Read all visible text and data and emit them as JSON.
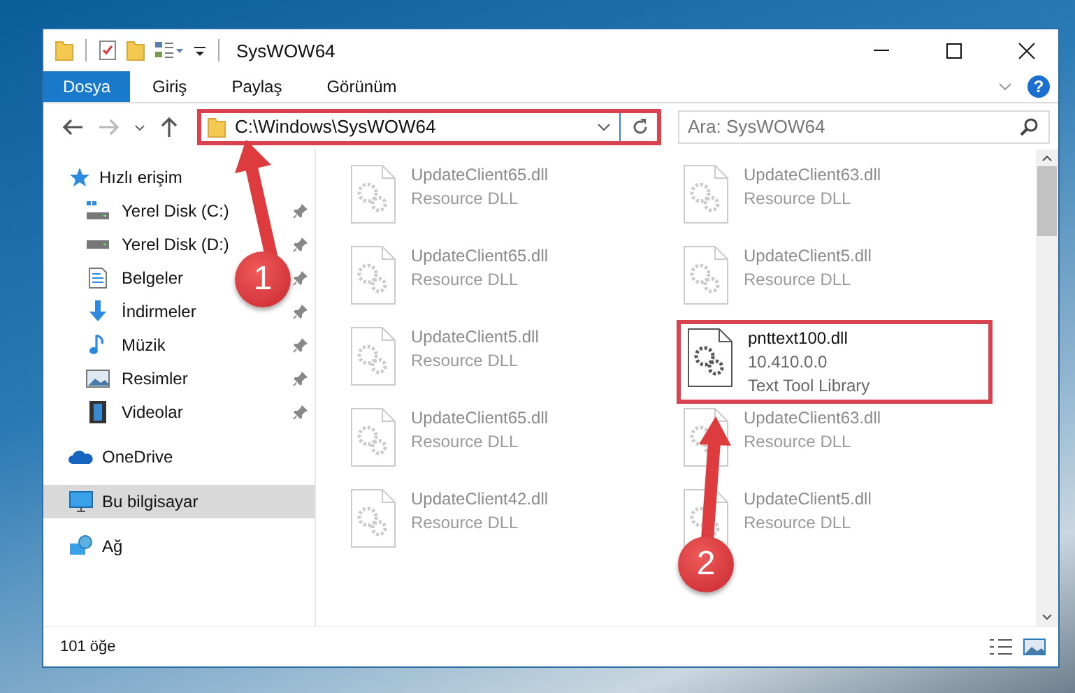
{
  "window": {
    "title": "SysWOW64"
  },
  "ribbon_tabs": [
    {
      "label": "Dosya",
      "selected": true
    },
    {
      "label": "Giriş",
      "selected": false
    },
    {
      "label": "Paylaş",
      "selected": false
    },
    {
      "label": "Görünüm",
      "selected": false
    }
  ],
  "help_button": {
    "label": "?"
  },
  "address_bar": {
    "path": "C:\\Windows\\SysWOW64",
    "highlighted": true
  },
  "search": {
    "placeholder": "Ara: SysWOW64"
  },
  "sidebar": {
    "items": [
      {
        "label": "Hızlı erişim",
        "kind": "star",
        "selected": false,
        "children": [
          {
            "label": "Yerel Disk (C:)",
            "kind": "drive-c",
            "pinned": true
          },
          {
            "label": "Yerel Disk (D:)",
            "kind": "drive",
            "pinned": true
          },
          {
            "label": "Belgeler",
            "kind": "documents",
            "pinned": true
          },
          {
            "label": "İndirmeler",
            "kind": "downloads",
            "pinned": true
          },
          {
            "label": "Müzik",
            "kind": "music",
            "pinned": true
          },
          {
            "label": "Resimler",
            "kind": "pictures",
            "pinned": true
          },
          {
            "label": "Videolar",
            "kind": "videos",
            "pinned": true
          }
        ]
      },
      {
        "label": "OneDrive",
        "kind": "cloud",
        "selected": false
      },
      {
        "label": "Bu bilgisayar",
        "kind": "computer",
        "selected": true
      },
      {
        "label": "Ağ",
        "kind": "network",
        "selected": false
      }
    ]
  },
  "files": [
    {
      "name": "UpdateClient65.dll",
      "description": "Resource DLL",
      "blurred": true,
      "highlighted": false
    },
    {
      "name": "UpdateClient63.dll",
      "description": "Resource DLL",
      "blurred": true,
      "highlighted": false
    },
    {
      "name": "UpdateClient65.dll",
      "description": "Resource DLL",
      "blurred": true,
      "highlighted": false
    },
    {
      "name": "UpdateClient5.dll",
      "description": "Resource DLL",
      "blurred": true,
      "highlighted": false
    },
    {
      "name": "UpdateClient5.dll",
      "description": "Resource DLL",
      "blurred": true,
      "highlighted": false
    },
    {
      "name": "pnttext100.dll",
      "version": "10.410.0.0",
      "description": "Text Tool Library",
      "blurred": false,
      "highlighted": true
    },
    {
      "name": "UpdateClient65.dll",
      "description": "Resource DLL",
      "blurred": true,
      "highlighted": false
    },
    {
      "name": "UpdateClient63.dll",
      "description": "Resource DLL",
      "blurred": true,
      "highlighted": false
    },
    {
      "name": "UpdateClient42.dll",
      "description": "Resource DLL",
      "blurred": true,
      "highlighted": false
    },
    {
      "name": "UpdateClient5.dll",
      "description": "Resource DLL",
      "blurred": true,
      "highlighted": false
    }
  ],
  "status_bar": {
    "item_count": "101 öğe"
  },
  "annotations": [
    {
      "number": "1"
    },
    {
      "number": "2"
    }
  ]
}
